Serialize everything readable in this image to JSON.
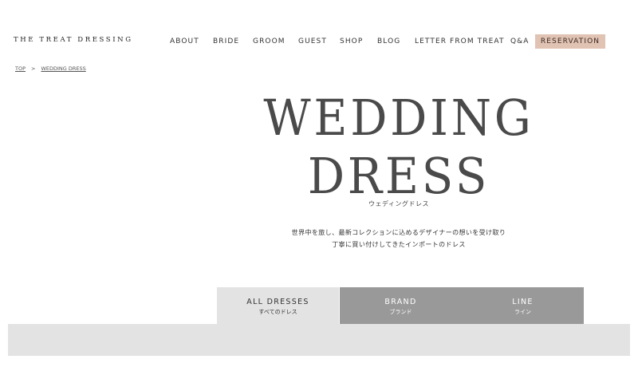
{
  "header": {
    "logo": "THE TREAT DRESSING",
    "nav": [
      {
        "label": "ABOUT"
      },
      {
        "label": "BRIDE"
      },
      {
        "label": "GROOM"
      },
      {
        "label": "GUEST"
      },
      {
        "label": "SHOP"
      },
      {
        "label": "BLOG"
      },
      {
        "label": "LETTER FROM TREAT"
      },
      {
        "label": "Q&A"
      }
    ],
    "reservation": "RESERVATION",
    "reservation_color": "#e1c3b3"
  },
  "breadcrumb": {
    "items": [
      "TOP",
      "WEDDING DRESS"
    ],
    "separator": ">"
  },
  "hero": {
    "title_line1": "WEDDING",
    "title_line2": "DRESS",
    "subtitle": "ウェディングドレス",
    "desc_line1": "世界中を旅し、最新コレクションに込めるデザイナーの想いを受け取り",
    "desc_line2": "丁寧に買い付けしてきたインポートのドレス"
  },
  "tabs": [
    {
      "label": "ALL DRESSES",
      "sub": "すべてのドレス",
      "active": true
    },
    {
      "label": "BRAND",
      "sub": "ブランド",
      "active": false
    },
    {
      "label": "LINE",
      "sub": "ライン",
      "active": false
    }
  ],
  "colors": {
    "tab_active": "#e3e3e3",
    "tab_inactive": "#999999"
  }
}
